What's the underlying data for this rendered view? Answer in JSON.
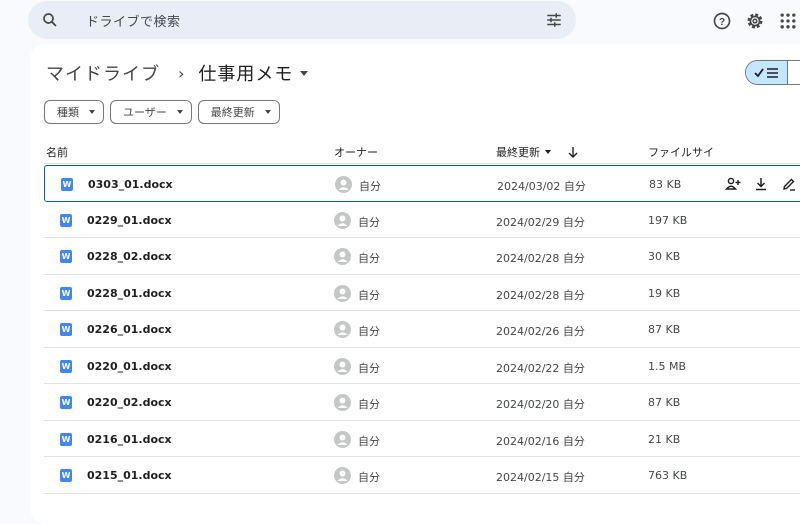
{
  "search": {
    "placeholder": "ドライブで検索"
  },
  "breadcrumb": {
    "root": "マイドライブ",
    "separator": "›",
    "current": "仕事用メモ"
  },
  "filters": [
    {
      "label": "種類"
    },
    {
      "label": "ユーザー"
    },
    {
      "label": "最終更新"
    }
  ],
  "columns": {
    "name": "名前",
    "owner": "オーナー",
    "modified": "最終更新",
    "size": "ファイルサイ"
  },
  "files": [
    {
      "name": "0303_01.docx",
      "owner": "自分",
      "modified": "2024/03/02 自分",
      "size": "83 KB",
      "selected": true
    },
    {
      "name": "0229_01.docx",
      "owner": "自分",
      "modified": "2024/02/29 自分",
      "size": "197 KB"
    },
    {
      "name": "0228_02.docx",
      "owner": "自分",
      "modified": "2024/02/28 自分",
      "size": "30 KB"
    },
    {
      "name": "0228_01.docx",
      "owner": "自分",
      "modified": "2024/02/28 自分",
      "size": "19 KB"
    },
    {
      "name": "0226_01.docx",
      "owner": "自分",
      "modified": "2024/02/26 自分",
      "size": "87 KB"
    },
    {
      "name": "0220_01.docx",
      "owner": "自分",
      "modified": "2024/02/22 自分",
      "size": "1.5 MB"
    },
    {
      "name": "0220_02.docx",
      "owner": "自分",
      "modified": "2024/02/20 自分",
      "size": "87 KB"
    },
    {
      "name": "0216_01.docx",
      "owner": "自分",
      "modified": "2024/02/16 自分",
      "size": "21 KB"
    },
    {
      "name": "0215_01.docx",
      "owner": "自分",
      "modified": "2024/02/15 自分",
      "size": "763 KB"
    }
  ],
  "file_type_glyph": "W",
  "colors": {
    "accent": "#0b57d0",
    "selected_toggle": "#c2e7ff",
    "doc_icon": "#4285f4",
    "search_bg": "#e9eef6"
  }
}
